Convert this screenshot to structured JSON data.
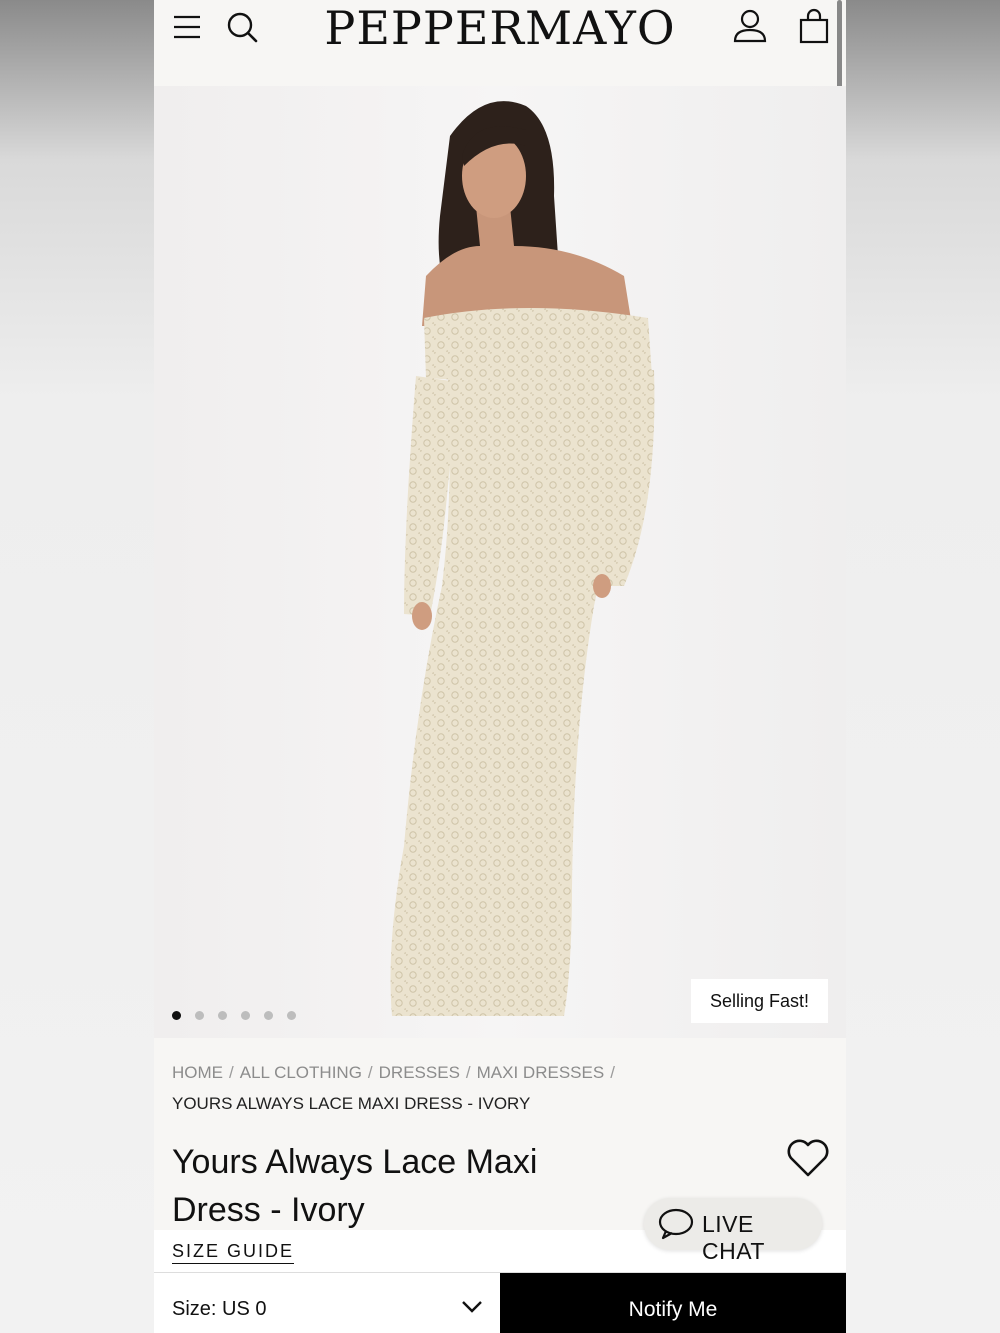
{
  "header": {
    "logo": "PEPPERMAYO",
    "icons": [
      "menu-icon",
      "search-icon",
      "account-icon",
      "bag-icon"
    ]
  },
  "hero": {
    "badge": "Selling Fast!",
    "carousel": {
      "total": 6,
      "active": 1
    }
  },
  "breadcrumb": {
    "items": [
      "HOME",
      "ALL CLOTHING",
      "DRESSES",
      "MAXI DRESSES"
    ],
    "separator": "/",
    "current": "YOURS ALWAYS LACE MAXI DRESS - IVORY"
  },
  "product": {
    "title_line1": "Yours Always Lace Maxi",
    "title_line2": "Dress - Ivory",
    "size_guide": "SIZE GUIDE"
  },
  "chat": {
    "label": "LIVE CHAT"
  },
  "purchase": {
    "size_label": "Size: US 0",
    "notify_label": "Notify Me"
  },
  "colors": {
    "accent": "#000000",
    "page_bg": "#f7f6f4",
    "dress": "#ece4d0"
  }
}
